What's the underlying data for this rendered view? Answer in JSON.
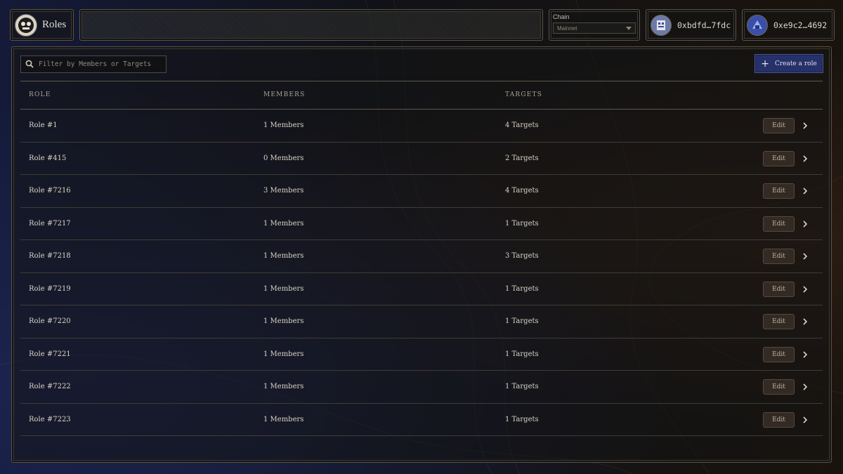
{
  "header": {
    "title": "Roles",
    "chain": {
      "label": "Chain",
      "value": "Mainnet"
    },
    "accounts": [
      {
        "address": "0xbdfd…7fdc"
      },
      {
        "address": "0xe9c2…4692"
      }
    ]
  },
  "toolbar": {
    "filter_placeholder": "Filter by Members or Targets",
    "create_label": "Create a role"
  },
  "table": {
    "columns": [
      "ROLE",
      "MEMBERS",
      "TARGETS"
    ],
    "edit_label": "Edit",
    "rows": [
      {
        "role": "Role #1",
        "members": "1 Members",
        "targets": "4 Targets"
      },
      {
        "role": "Role #415",
        "members": "0 Members",
        "targets": "2 Targets"
      },
      {
        "role": "Role #7216",
        "members": "3 Members",
        "targets": "4 Targets"
      },
      {
        "role": "Role #7217",
        "members": "1 Members",
        "targets": "1 Targets"
      },
      {
        "role": "Role #7218",
        "members": "1 Members",
        "targets": "3 Targets"
      },
      {
        "role": "Role #7219",
        "members": "1 Members",
        "targets": "1 Targets"
      },
      {
        "role": "Role #7220",
        "members": "1 Members",
        "targets": "1 Targets"
      },
      {
        "role": "Role #7221",
        "members": "1 Members",
        "targets": "1 Targets"
      },
      {
        "role": "Role #7222",
        "members": "1 Members",
        "targets": "1 Targets"
      },
      {
        "role": "Role #7223",
        "members": "1 Members",
        "targets": "1 Targets"
      }
    ]
  },
  "colors": {
    "accent": "#263069",
    "border": "#5e594c",
    "text": "#d9d4c7"
  }
}
